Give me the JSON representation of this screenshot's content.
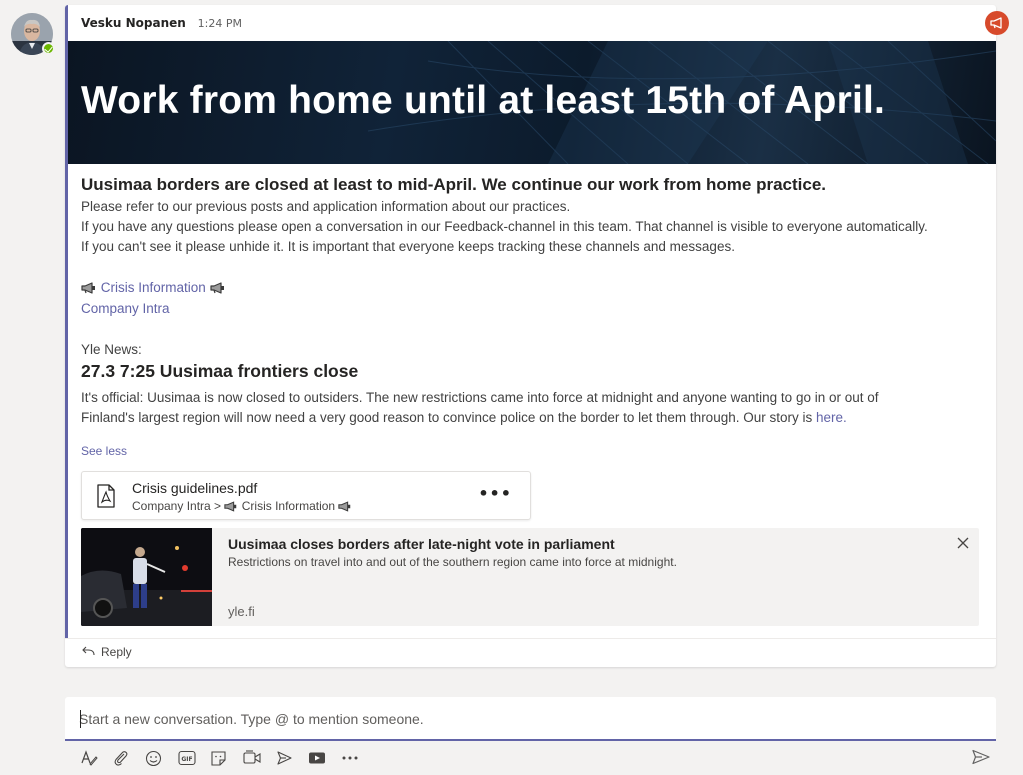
{
  "post": {
    "author": "Vesku Nopanen",
    "time": "1:24 PM",
    "banner_title": "Work from home until at least 15th of April.",
    "subject": "Uusimaa borders are closed at least to mid-April. We continue our work from home practice.",
    "body_lines": [
      "Please refer to our previous posts and application information about our practices.",
      "If you have any questions please open a conversation in our Feedback-channel in this team. That channel is visible to everyone automatically.",
      "If you can't see it please unhide it. It is important that everyone keeps tracking these channels and messages."
    ],
    "crisis_link": "Crisis Information",
    "company_link": "Company Intra",
    "news_label": "Yle News:",
    "news_title": "27.3 7:25 Uusimaa frontiers close",
    "news_line1": "It's official: Uusimaa is now closed to outsiders. The new restrictions came into force at midnight and anyone wanting to go in or out of",
    "news_line2": "Finland's largest region will now need a very good reason to convince police on the border to let them through. Our story is ",
    "news_link": "here.",
    "see_less": "See less",
    "reply": "Reply"
  },
  "file_card": {
    "name": "Crisis guidelines.pdf",
    "path_root": "Company Intra",
    "path_sep": ">",
    "path_channel": "Crisis Information",
    "more": "•••"
  },
  "link_card": {
    "title": "Uusimaa closes borders after late-night vote in parliament",
    "description": "Restrictions on travel into and out of the southern region came into force at midnight.",
    "domain": "yle.fi"
  },
  "composer": {
    "placeholder": "Start a new conversation. Type @ to mention someone."
  },
  "toolbar_icons": [
    "format-icon",
    "attach-icon",
    "emoji-icon",
    "gif-icon",
    "sticker-icon",
    "meet-now-icon",
    "stream-icon",
    "video-icon",
    "more-icon",
    "send-icon"
  ],
  "colors": {
    "accent": "#6264a7",
    "announcement_badge": "#d74a2b",
    "presence": "#6bb700"
  }
}
